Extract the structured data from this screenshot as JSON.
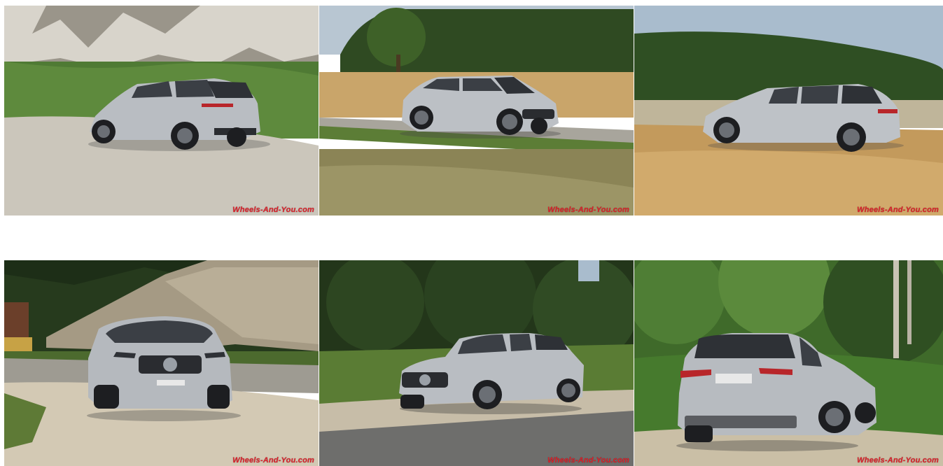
{
  "gallery": {
    "watermark": "Wheels-And-You.com",
    "photos": [
      {
        "label": "Silver SUV rear three-quarter view on gravel road"
      },
      {
        "label": "Silver SUV front three-quarter view beside wheat field"
      },
      {
        "label": "Silver SUV side view driving past wheat field"
      },
      {
        "label": "Silver SUV front view on gravel road by rock slope"
      },
      {
        "label": "Silver SUV front three-quarter view in front of trees"
      },
      {
        "label": "Silver SUV rear view parked by green bushes"
      }
    ]
  },
  "colors": {
    "watermark": "#e0202a",
    "car_silver": "#b9bdc2",
    "foliage": "#3c5a2a",
    "wheat": "#c9a56a",
    "gravel": "#cfc9bd"
  }
}
